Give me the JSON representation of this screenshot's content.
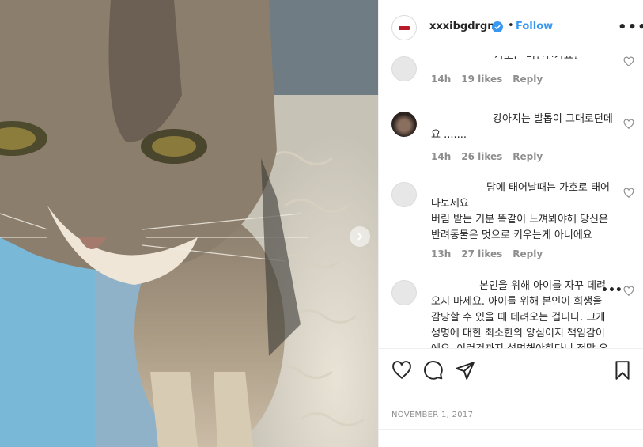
{
  "post": {
    "username": "xxxibgdrgn",
    "follow_label": "Follow",
    "dot": "•",
    "more": "•••",
    "date": "NOVEMBER 1, 2017"
  },
  "comments": [
    {
      "text": "가호는 버린건가요?",
      "age": "14h",
      "likes": "19 likes",
      "reply": "Reply"
    },
    {
      "text": "강아지는 발톱이 그대로던데요 .......",
      "age": "14h",
      "likes": "26 likes",
      "reply": "Reply"
    },
    {
      "text1": "담에 태어날때는 가호로 태어나보세요",
      "text2": "버림 받는 기분 똑같이 느껴봐야해 당신은 반려동물은 멋으로 키우는게 아니에요",
      "age": "13h",
      "likes": "27 likes",
      "reply": "Reply"
    },
    {
      "text": "본인을 위해 아이를 자꾸 데려오지 마세요. 아이를 위해 본인이 희생을 감당할 수 있을 때 데려오는 겁니다. 그게 생명에 대한 최소한의 양심이지 책임감이에요. 이런것까지 설명해야한다니 정말 우",
      "more": "•••"
    }
  ],
  "icons": {
    "verified": "verified-badge-icon",
    "like": "heart-outline-icon",
    "comment": "comment-icon",
    "share": "paper-plane-icon",
    "save": "bookmark-icon",
    "next": "chevron-right-icon"
  },
  "colors": {
    "link": "#3897f0",
    "muted": "#8e8e8e",
    "text": "#262626",
    "border": "#efefef"
  }
}
